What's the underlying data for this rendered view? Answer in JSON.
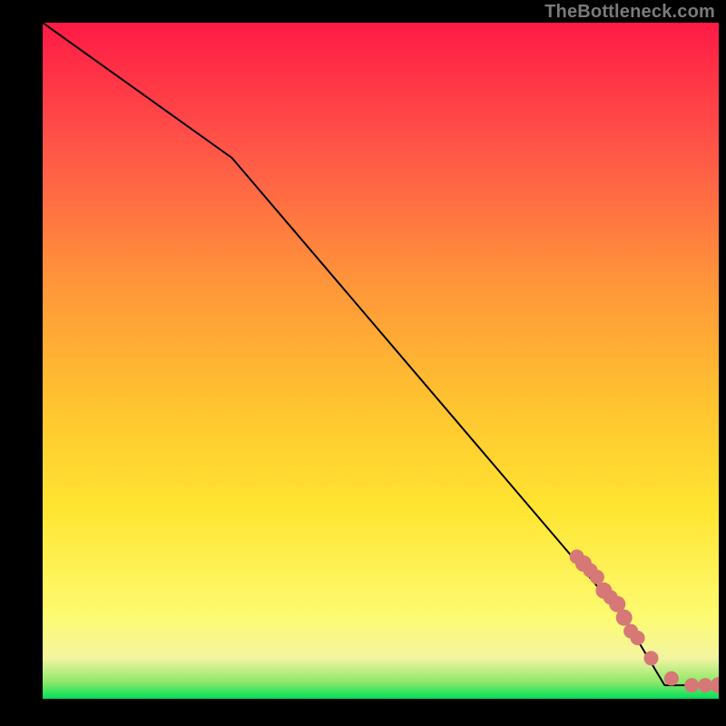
{
  "watermark": "TheBottleneck.com",
  "chart_data": {
    "type": "line",
    "title": "",
    "xlabel": "",
    "ylabel": "",
    "xlim": [
      0,
      100
    ],
    "ylim": [
      0,
      100
    ],
    "grid": false,
    "legend": null,
    "background": "rainbow-vertical",
    "curve": {
      "name": "bottleneck-curve",
      "x": [
        0,
        28,
        86,
        92,
        100
      ],
      "y": [
        100,
        80,
        12,
        2,
        2
      ]
    },
    "points": {
      "name": "sample-points",
      "color": "#d67875",
      "x": [
        79,
        80,
        81,
        82,
        83,
        84,
        85,
        86,
        87,
        88,
        90,
        93,
        96,
        98,
        100
      ],
      "y": [
        21,
        20,
        19,
        18,
        16,
        15,
        14,
        12,
        10,
        9,
        6,
        3,
        2,
        2,
        2
      ],
      "r": [
        8,
        9,
        8,
        8,
        9,
        8,
        9,
        9,
        8,
        8,
        8,
        8,
        8,
        8,
        9
      ]
    },
    "gradient_stops": [
      {
        "offset": 0.0,
        "color": "#00e05a"
      },
      {
        "offset": 0.025,
        "color": "#8fe86a"
      },
      {
        "offset": 0.06,
        "color": "#f3f4a0"
      },
      {
        "offset": 0.12,
        "color": "#fdfb72"
      },
      {
        "offset": 0.28,
        "color": "#ffe531"
      },
      {
        "offset": 0.45,
        "color": "#ffc030"
      },
      {
        "offset": 0.62,
        "color": "#ff943a"
      },
      {
        "offset": 0.8,
        "color": "#ff5a47"
      },
      {
        "offset": 1.0,
        "color": "#ff1a46"
      }
    ]
  }
}
